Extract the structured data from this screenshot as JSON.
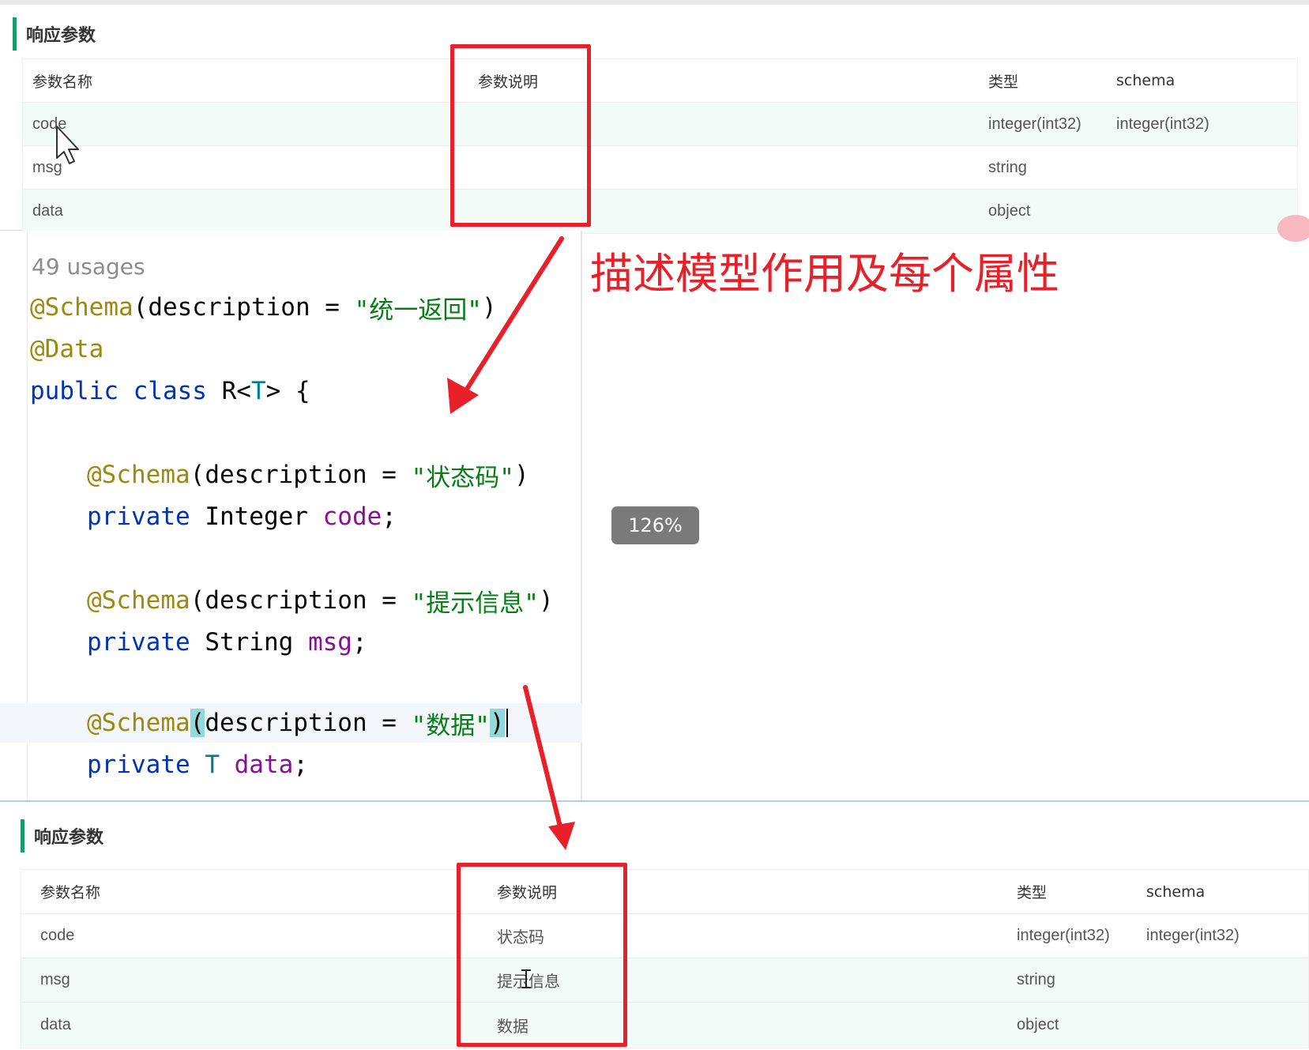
{
  "top_panel": {
    "title": "响应参数",
    "headers": {
      "name": "参数名称",
      "desc": "参数说明",
      "type": "类型",
      "schema": "schema"
    },
    "rows": [
      {
        "name": "code",
        "desc": "",
        "type": "integer(int32)",
        "schema": "integer(int32)"
      },
      {
        "name": "msg",
        "desc": "",
        "type": "string",
        "schema": ""
      },
      {
        "name": "data",
        "desc": "",
        "type": "object",
        "schema": ""
      }
    ]
  },
  "annotation": "描述模型作用及每个属性",
  "zoom_badge": "126%",
  "code": {
    "usages": "49 usages",
    "lines": {
      "l1_ann": "@Schema",
      "l1_rest": "(description = ",
      "l1_str": "\"统一返回\"",
      "l1_end": ")",
      "l2_ann": "@Data",
      "l3_kw": "public class ",
      "l3_cls": "R<",
      "l3_gen": "T",
      "l3_end": "> {",
      "l5_ann": "@Schema",
      "l5_rest": "(description = ",
      "l5_str": "\"状态码\"",
      "l5_end": ")",
      "l6_kw": "private ",
      "l6_type": "Integer ",
      "l6_field": "code",
      "l6_end": ";",
      "l8_ann": "@Schema",
      "l8_rest": "(description = ",
      "l8_str": "\"提示信息\"",
      "l8_end": ")",
      "l9_kw": "private ",
      "l9_type": "String ",
      "l9_field": "msg",
      "l9_end": ";",
      "l11_ann": "@Schema",
      "l11_open": "(",
      "l11_rest": "description = ",
      "l11_str": "\"数据\"",
      "l11_end": ")",
      "l12_kw": "private ",
      "l12_type": "T ",
      "l12_field": "data",
      "l12_end": ";"
    }
  },
  "bottom_panel": {
    "title": "响应参数",
    "headers": {
      "name": "参数名称",
      "desc": "参数说明",
      "type": "类型",
      "schema": "schema"
    },
    "rows": [
      {
        "name": "code",
        "desc": "状态码",
        "type": "integer(int32)",
        "schema": "integer(int32)"
      },
      {
        "name": "msg",
        "desc": "提示信息",
        "type": "string",
        "schema": ""
      },
      {
        "name": "data",
        "desc": "数据",
        "type": "object",
        "schema": ""
      }
    ]
  },
  "colors": {
    "accent_red": "#e8202a",
    "title_bar_green": "#1a9a6c",
    "row_alt_bg": "#f3fbf8"
  },
  "icons": [
    "mouse-pointer-icon",
    "text-cursor-icon"
  ]
}
